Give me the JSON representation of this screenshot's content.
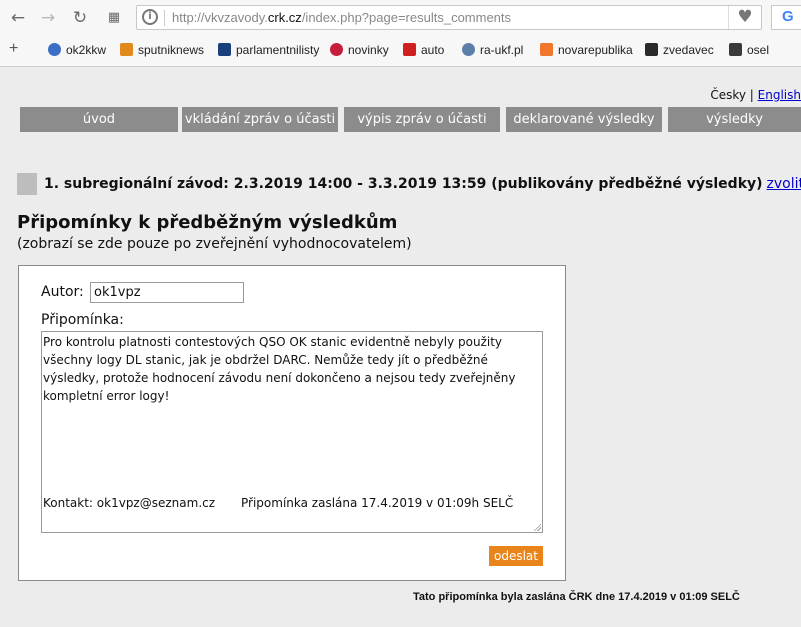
{
  "browser": {
    "url_prefix": "http://vkvzavody.",
    "url_domain": "crk.cz",
    "url_suffix": "/index.php?page=results_comments",
    "search_engine_letter": "G",
    "bookmarks": [
      {
        "label": "ok2kkw",
        "icon": "globe-icon",
        "color": "#3b6fc4"
      },
      {
        "label": "sputniknews",
        "icon": "sputnik-icon",
        "color": "#e08a1e"
      },
      {
        "label": "parlamentnilisty",
        "icon": "pl-icon",
        "color": "#1b3f7a"
      },
      {
        "label": "novinky",
        "icon": "novinky-icon",
        "color": "#c41e3a"
      },
      {
        "label": "auto",
        "icon": "acz-icon",
        "color": "#d01f1f"
      },
      {
        "label": "ra-ukf.pl",
        "icon": "people-icon",
        "color": "#5b7fa8"
      },
      {
        "label": "novarepublika",
        "icon": "blogger-icon",
        "color": "#f0762a"
      },
      {
        "label": "zvedavec",
        "icon": "zvedavec-icon",
        "color": "#2a2a2a"
      },
      {
        "label": "osel",
        "icon": "osel-icon",
        "color": "#3a3a3a"
      }
    ]
  },
  "page": {
    "languages": {
      "cz": "Česky",
      "separator": "|",
      "en": "English"
    },
    "menu": [
      "úvod",
      "vkládání zpráv o účasti",
      "výpis zpráv o účasti",
      "deklarované výsledky",
      "výsledky"
    ],
    "contest_heading": "1. subregionální závod: 2.3.2019 14:00 - 3.3.2019 13:59 (publikovány předběžné výsledky)",
    "change_link": "zvolit jiný",
    "title": "Připomínky k předběžným výsledkům",
    "subtitle": "(zobrazí se zde pouze po zveřejnění vyhodnocovatelem)",
    "form": {
      "author_label": "Autor:",
      "author_value": "ok1vpz",
      "comment_label": "Připomínka:",
      "comment_text": "Pro kontrolu platnosti contestových QSO OK stanic evidentně nebyly použity všechny logy DL stanic, jak je obdržel DARC. Nemůže tedy jít o předběžné výsledky, protože hodnocení závodu není dokončeno a nejsou tedy zveřejněny kompletní error logy!",
      "contact": "Kontakt: ok1vpz@seznam.cz",
      "sent_info": "Připomínka zaslána 17.4.2019 v 01:09h SELČ",
      "submit_label": "odeslat"
    },
    "footnote": "Tato připomínka byla zaslána ČRK dne 17.4.2019 v 01:09 SELČ"
  }
}
